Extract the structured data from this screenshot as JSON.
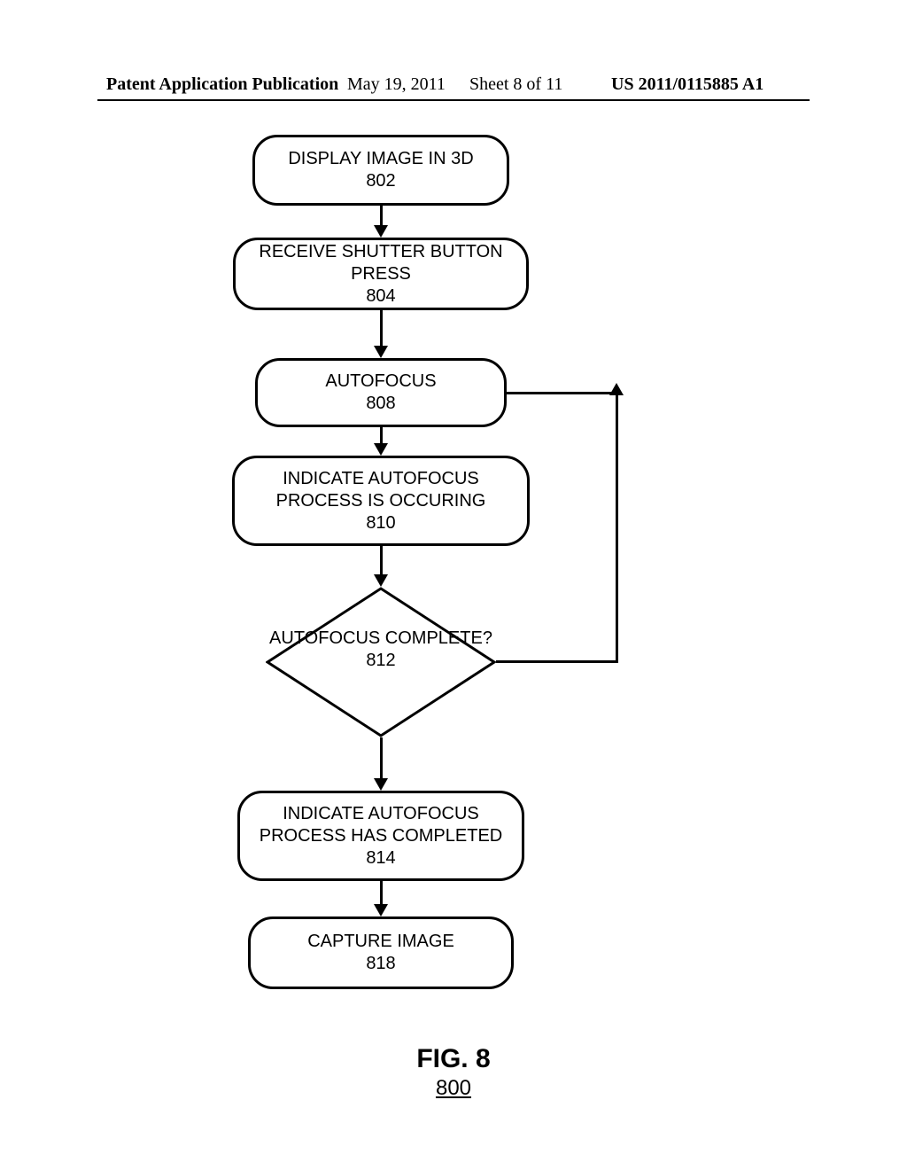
{
  "header": {
    "left": "Patent Application Publication",
    "date": "May 19, 2011",
    "sheet": "Sheet 8 of 11",
    "docnum": "US 2011/0115885 A1"
  },
  "flowchart": {
    "boxes": {
      "b802": {
        "title": "DISPLAY IMAGE IN 3D",
        "num": "802"
      },
      "b804": {
        "title": "RECEIVE SHUTTER BUTTON PRESS",
        "num": "804"
      },
      "b808": {
        "title": "AUTOFOCUS",
        "num": "808"
      },
      "b810": {
        "title": "INDICATE AUTOFOCUS PROCESS IS OCCURING",
        "num": "810"
      },
      "b812": {
        "title": "AUTOFOCUS COMPLETE?",
        "num": "812"
      },
      "b814": {
        "title": "INDICATE AUTOFOCUS PROCESS HAS COMPLETED",
        "num": "814"
      },
      "b818": {
        "title": "CAPTURE IMAGE",
        "num": "818"
      }
    }
  },
  "figure": {
    "label": "FIG. 8",
    "num": "800"
  }
}
